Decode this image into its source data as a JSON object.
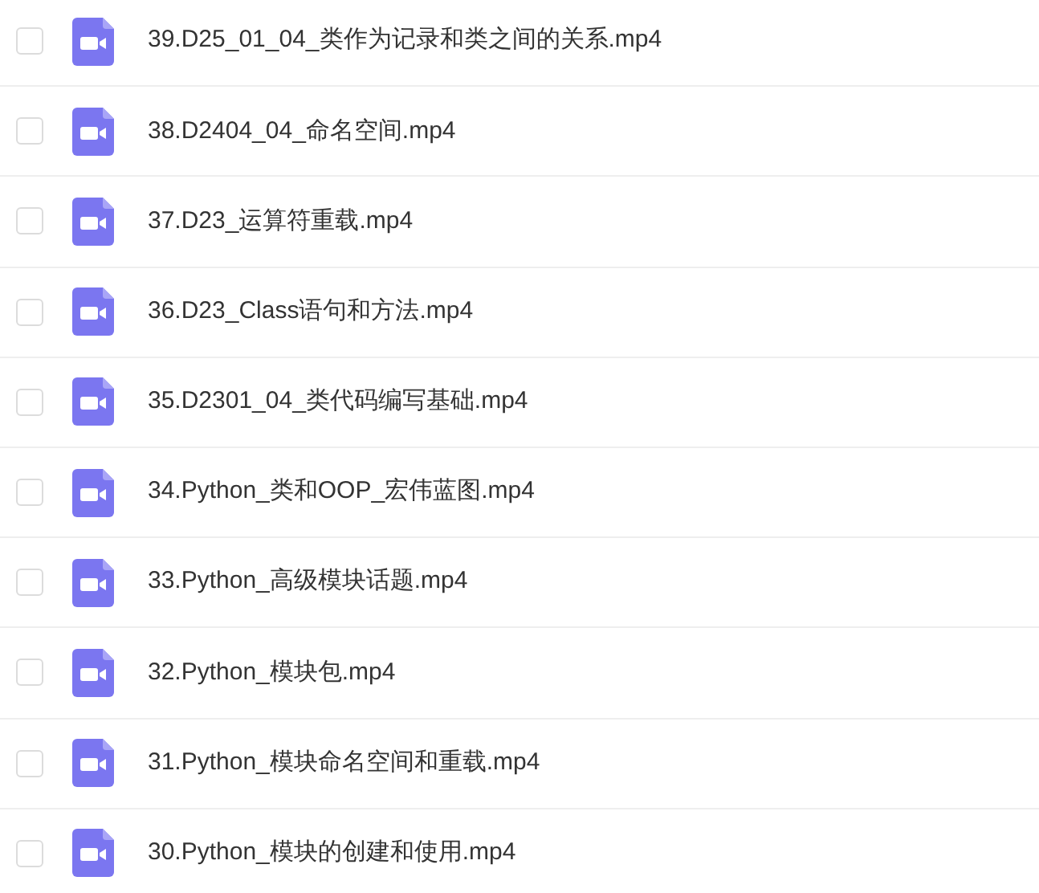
{
  "files": [
    {
      "name": "39.D25_01_04_类作为记录和类之间的关系.mp4",
      "checked": false
    },
    {
      "name": "38.D2404_04_命名空间.mp4",
      "checked": false
    },
    {
      "name": "37.D23_运算符重载.mp4",
      "checked": false
    },
    {
      "name": "36.D23_Class语句和方法.mp4",
      "checked": false
    },
    {
      "name": "35.D2301_04_类代码编写基础.mp4",
      "checked": false
    },
    {
      "name": "34.Python_类和OOP_宏伟蓝图.mp4",
      "checked": false
    },
    {
      "name": "33.Python_高级模块话题.mp4",
      "checked": false
    },
    {
      "name": "32.Python_模块包.mp4",
      "checked": false
    },
    {
      "name": "31.Python_模块命名空间和重载.mp4",
      "checked": false
    },
    {
      "name": "30.Python_模块的创建和使用.mp4",
      "checked": false
    }
  ]
}
